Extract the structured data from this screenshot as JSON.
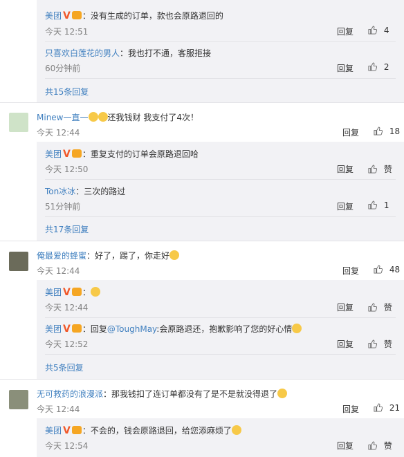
{
  "threads": [
    {
      "replies": [
        {
          "user": "美团",
          "text": "：没有生成的订单，款也会原路退回的",
          "time": "今天 12:51",
          "reply": "回复",
          "likes": "4"
        },
        {
          "user": "只喜欢白莲花的男人",
          "text": "：我也打不通，客服拒接",
          "time": "60分钟前",
          "reply": "回复",
          "likes": "2"
        }
      ],
      "more": "共15条回复"
    },
    {
      "user": "Minew一直一",
      "text": "还我钱财 我支付了4次！",
      "time": "今天 12:44",
      "reply": "回复",
      "likes": "18",
      "replies": [
        {
          "user": "美团",
          "text": "：重复支付的订单会原路退回哈",
          "time": "今天 12:50",
          "reply": "回复",
          "likes": "赞"
        },
        {
          "user": "Ton冰冰",
          "text": "：三次的路过",
          "time": "51分钟前",
          "reply": "回复",
          "likes": "1"
        }
      ],
      "more": "共17条回复"
    },
    {
      "user": "俺最爱的蜂蜜",
      "text": "：好了，踢了，你走好",
      "time": "今天 12:44",
      "reply": "回复",
      "likes": "48",
      "replies": [
        {
          "user": "美团",
          "text": "：",
          "time": "今天 12:44",
          "reply": "回复",
          "likes": "赞"
        },
        {
          "user": "美团",
          "text_prefix": "：回复",
          "mention": "@ToughMay",
          "text": ":会原路退还，抱歉影响了您的好心情",
          "time": "今天 12:52",
          "reply": "回复",
          "likes": "赞"
        }
      ],
      "more": "共5条回复"
    },
    {
      "user": "无可救药的浪漫派",
      "text": "：那我钱扣了连订单都没有了是不是就没得退了",
      "time": "今天 12:44",
      "reply": "回复",
      "likes": "21",
      "replies": [
        {
          "user": "美团",
          "text": "：不会的，钱会原路退回，给您添麻烦了",
          "time": "今天 12:54",
          "reply": "回复",
          "likes": "赞"
        }
      ]
    }
  ],
  "verified_badge": "V"
}
